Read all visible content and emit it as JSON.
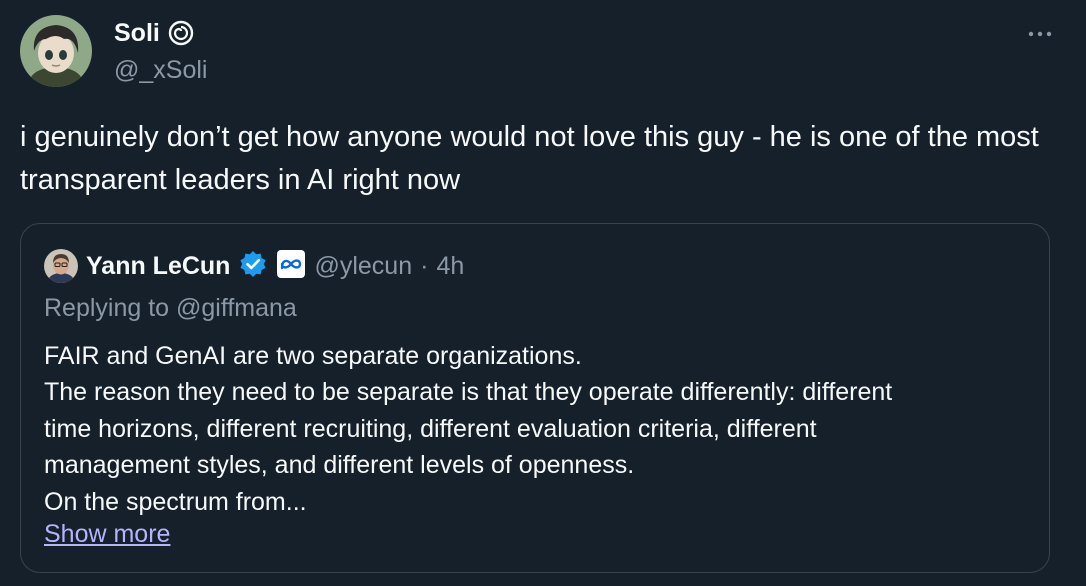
{
  "tweet": {
    "author": {
      "name": "Soli",
      "name_icon": "spiral-icon",
      "handle": "@_xSoli"
    },
    "more_icon": "more-horizontal-icon",
    "text": "i genuinely don’t get how anyone would not love this guy - he is one of the most transparent leaders in AI right now"
  },
  "quote": {
    "author": {
      "name": "Yann LeCun",
      "verified_icon": "verified-badge-icon",
      "affiliation_icon": "meta-logo-icon",
      "handle": "@ylecun",
      "separator": "·",
      "time": "4h"
    },
    "replying_to": "Replying to @giffmana",
    "lines": [
      "FAIR and GenAI are two separate organizations.",
      "The reason they need to be separate is that they operate differently: different",
      "time horizons, different recruiting, different evaluation criteria, different",
      "management styles, and different levels of openness.",
      "On the spectrum from..."
    ],
    "show_more": "Show more"
  },
  "colors": {
    "background": "#15202b",
    "text": "#f7f9f9",
    "secondary": "#8b98a5",
    "border": "#38444d",
    "verified": "#1d9bf0",
    "link": "#b4b4f8"
  }
}
